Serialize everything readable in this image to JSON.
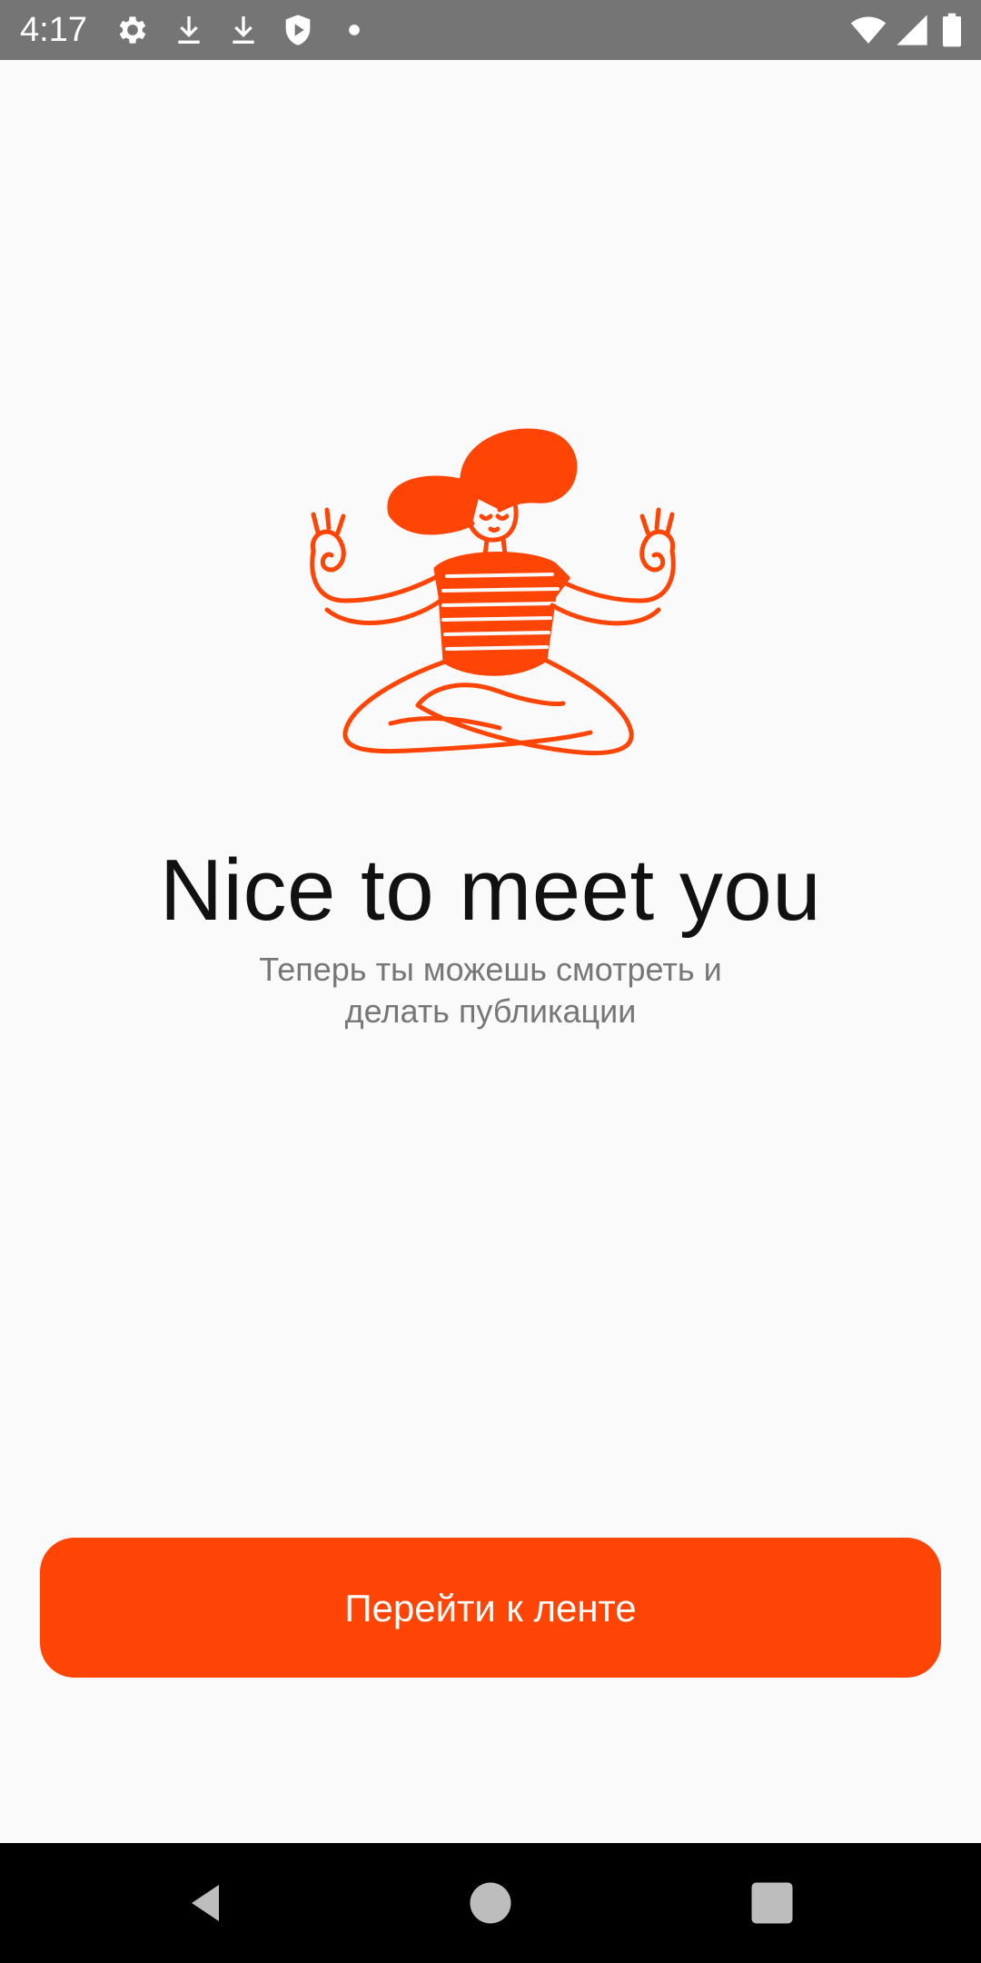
{
  "status_bar": {
    "time": "4:17",
    "left_icons": [
      "gear-icon",
      "download-icon",
      "download-icon",
      "shield-play-icon",
      "dot-icon"
    ],
    "right_icons": [
      "wifi-icon",
      "signal-icon",
      "battery-icon"
    ]
  },
  "main": {
    "illustration": "meditating-woman-illustration",
    "title": "Nice to meet you",
    "subtitle_line1": "Теперь ты можешь смотреть и",
    "subtitle_line2": "делать публикации",
    "button_label": "Перейти к ленте"
  },
  "nav_bar": {
    "items": [
      "back-icon",
      "home-icon",
      "recents-icon"
    ]
  },
  "colors": {
    "accent": "#ff4506",
    "status_bar": "#757575",
    "background": "#fafafa",
    "title": "#111111",
    "subtitle": "#777777",
    "nav_bar": "#000000"
  }
}
